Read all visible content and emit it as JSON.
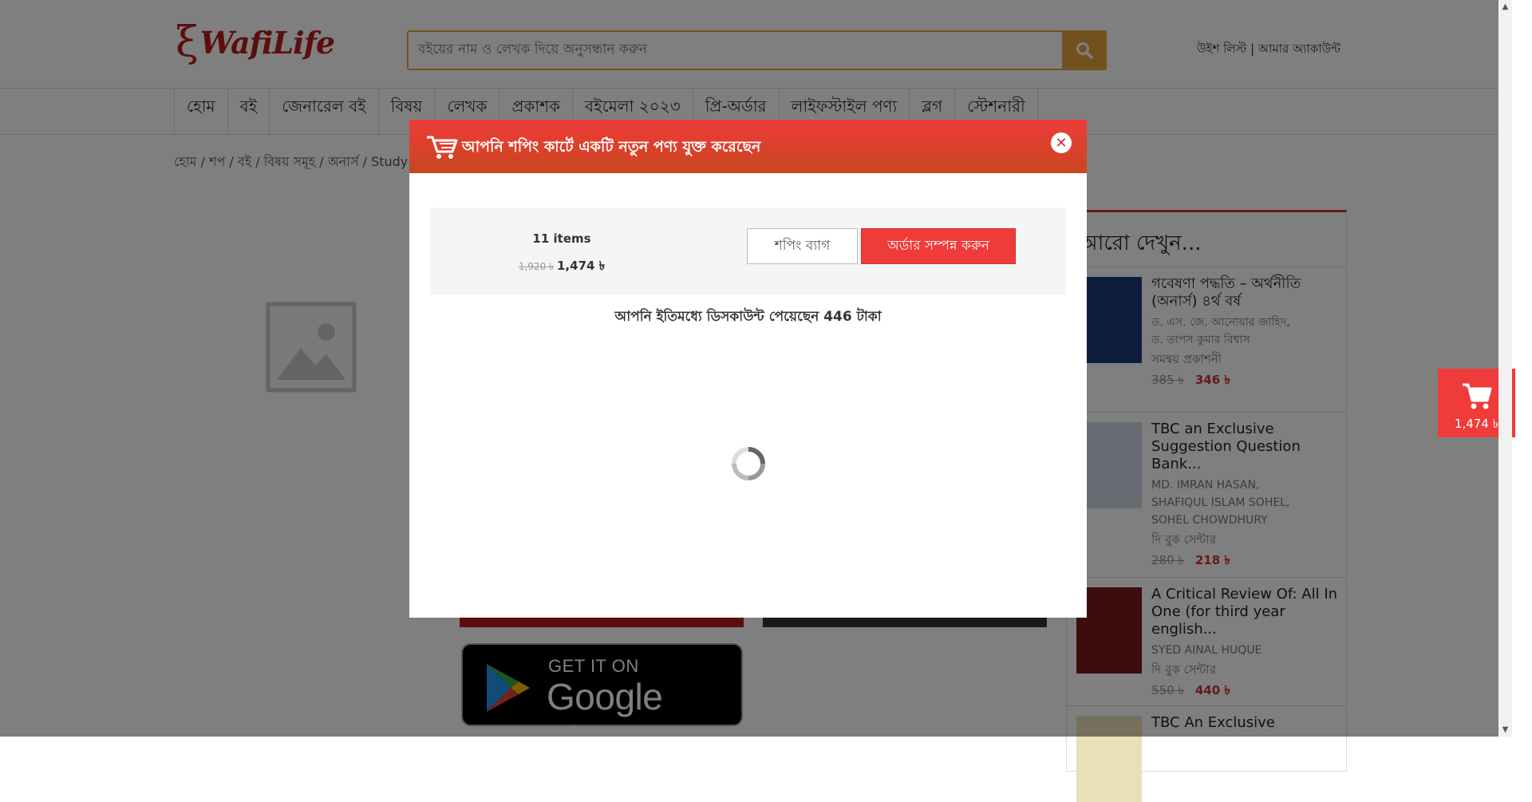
{
  "header": {
    "logo_text": "WafiLife",
    "search_placeholder": "বইয়ের নাম ও লেখক দিয়ে অনুসন্ধান করুন",
    "wishlist_label": "উইশ লিস্ট",
    "link_separator": "|",
    "account_label": "আমার অ্যাকাউন্ট"
  },
  "nav": {
    "items": [
      "হোম",
      "বই",
      "জেনারেল বই",
      "বিষয়",
      "লেখক",
      "প্রকাশক",
      "বইমেলা ২০২৩",
      "প্রি-অর্ডার",
      "লাইফস্টাইল পণ্য",
      "ব্লগ",
      "স্টেশনারী"
    ]
  },
  "breadcrumb": "হোম / শপ / বই / বিষয় সমূহ / অনার্স / Study",
  "app_badge": {
    "line1": "GET IT ON",
    "line2": "Google Play"
  },
  "sidebar": {
    "title": "আরো দেখুন...",
    "items": [
      {
        "name": "গবেষণা পদ্ধতি – অর্থনীতি (অনার্স) ৪র্থ বর্ষ",
        "authors": [
          "ড. এস. জে. আনোয়ার জাহিদ,",
          "ড. তাপস কুমার বিশ্বাস"
        ],
        "publisher": "সমন্বয় প্রকাশনী",
        "old_price": "385 ৳",
        "new_price": "346 ৳",
        "cover_color": "#1f3a7a"
      },
      {
        "name": "TBC an Exclusive Suggestion Question Bank...",
        "authors": [
          "MD. IMRAN HASAN,",
          "SHAFIQUL ISLAM SOHEL,",
          "SOHEL CHOWDHURY"
        ],
        "publisher": "দি বুক সেন্টার",
        "old_price": "280 ৳",
        "new_price": "218 ৳",
        "cover_color": "#cfd8e6"
      },
      {
        "name": "A Critical Review Of: All In One (for third year english...",
        "authors": [
          "SYED AINAL HUQUE"
        ],
        "publisher": "দি বুক সেন্টার",
        "old_price": "550 ৳",
        "new_price": "440 ৳",
        "cover_color": "#7a1a1a"
      },
      {
        "name": "TBC An Exclusive",
        "authors": [],
        "publisher": "",
        "old_price": "",
        "new_price": "",
        "cover_color": "#e8e0b8"
      }
    ]
  },
  "modal": {
    "title": "আপনি শপিং কার্টে একটি নতুন পণ্য যুক্ত করেছেন",
    "items_count": "11 items",
    "original_total": "1,920 ৳",
    "total": "1,474 ৳",
    "bag_button": "শপিং ব্যাগ",
    "order_button": "অর্ডার সম্পন্ন করুন",
    "discount_message": "আপনি ইতিমধ্যে ডিসকাউন্ট পেয়েছেন 446 টাকা"
  },
  "floating_cart": {
    "price": "1,474 ৳"
  },
  "colors": {
    "brand_red": "#ef3b39",
    "search_accent": "#e6a23c",
    "price_red": "#d32f2f"
  }
}
